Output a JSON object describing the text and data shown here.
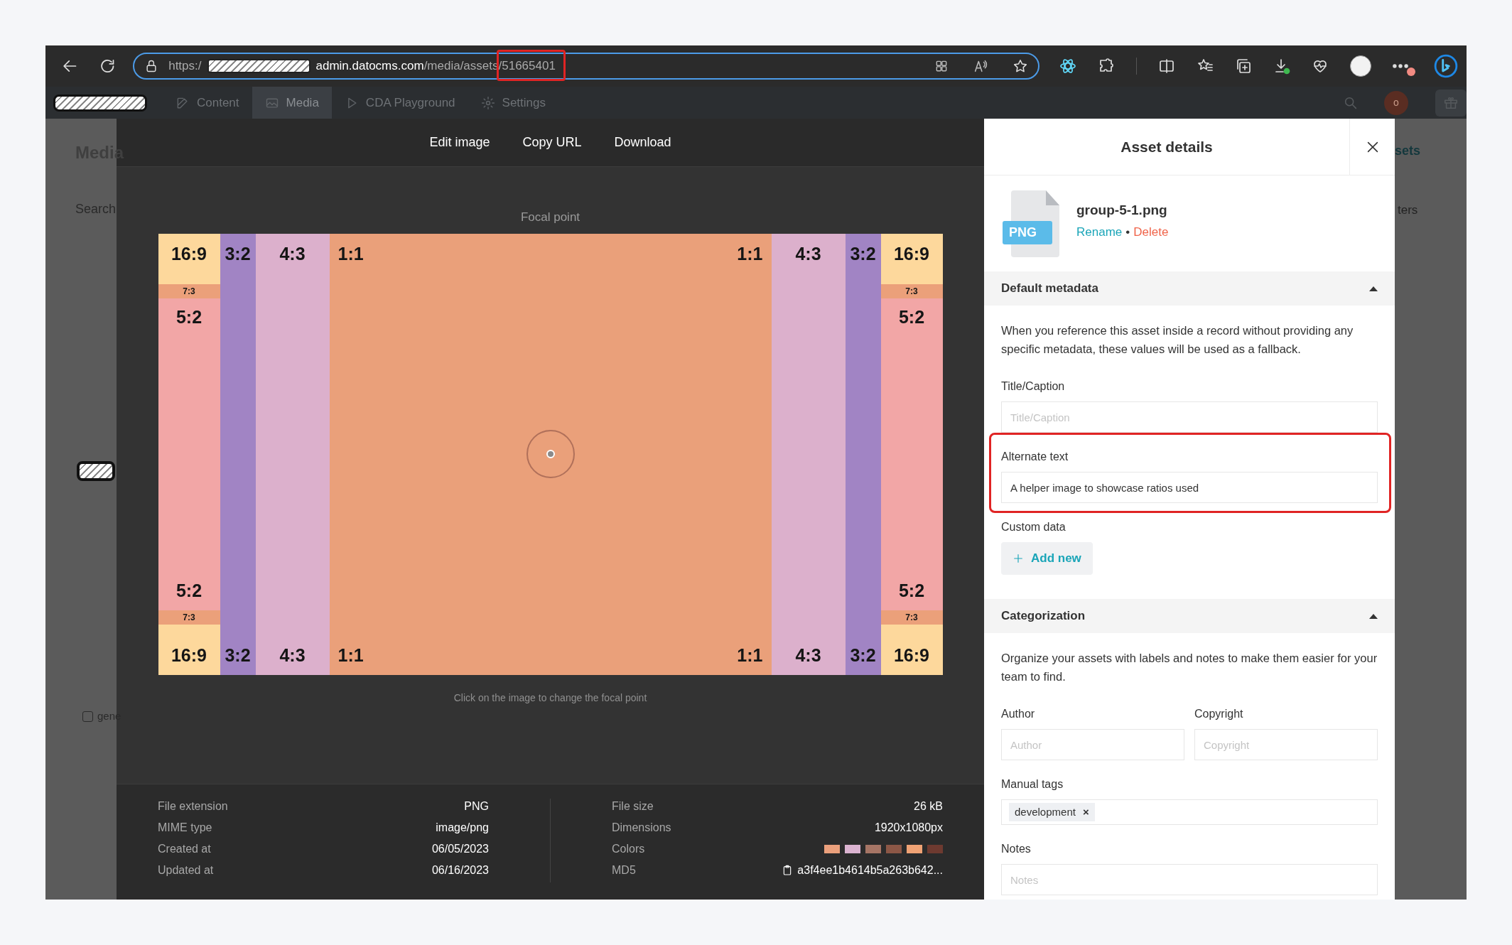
{
  "browser": {
    "url": {
      "scheme": "https:/",
      "host": "admin.datocms.com",
      "path": "/media/assets/",
      "asset_id": "51665401"
    }
  },
  "nav": {
    "items": [
      {
        "label": "Content",
        "selected": false
      },
      {
        "label": "Media",
        "selected": true
      },
      {
        "label": "CDA Playground",
        "selected": false
      },
      {
        "label": "Settings",
        "selected": false
      }
    ],
    "avatar": "o"
  },
  "background": {
    "heading": "Media",
    "search": "Search",
    "checkbox_label": "gene",
    "checkbox_checked": false,
    "right_link": "sets",
    "right_filter": "ters"
  },
  "toolbar": [
    "Edit image",
    "Copy URL",
    "Download"
  ],
  "preview": {
    "label": "Focal point",
    "hint": "Click on the image to change the focal point",
    "columns": [
      {
        "kind": "edge",
        "top": "16:9",
        "strip_top": "7:3",
        "band_top": "5:2",
        "band_bottom": "5:2",
        "strip_bottom": "7:3",
        "bottom": "16:9"
      },
      {
        "kind": "band",
        "color": "#a184c4",
        "top": "3:2",
        "bottom": "3:2"
      },
      {
        "kind": "band",
        "color": "#dcb0cc",
        "top": "4:3",
        "bottom": "4:3"
      },
      {
        "kind": "center",
        "top_left": "1:1",
        "top_right": "1:1",
        "bottom_left": "1:1",
        "bottom_right": "1:1"
      },
      {
        "kind": "band",
        "color": "#dcb0cc",
        "top": "4:3",
        "bottom": "4:3"
      },
      {
        "kind": "band",
        "color": "#a184c4",
        "top": "3:2",
        "bottom": "3:2"
      },
      {
        "kind": "edge",
        "top": "16:9",
        "strip_top": "7:3",
        "band_top": "5:2",
        "band_bottom": "5:2",
        "strip_bottom": "7:3",
        "bottom": "16:9"
      }
    ]
  },
  "info": {
    "left": [
      {
        "label": "File extension",
        "value": "PNG"
      },
      {
        "label": "MIME type",
        "value": "image/png"
      },
      {
        "label": "Created at",
        "value": "06/05/2023"
      },
      {
        "label": "Updated at",
        "value": "06/16/2023"
      }
    ],
    "right": [
      {
        "kind": "text",
        "label": "File size",
        "value": "26 kB"
      },
      {
        "kind": "text",
        "label": "Dimensions",
        "value": "1920x1080px"
      },
      {
        "kind": "colors",
        "label": "Colors",
        "colors": [
          {
            "color": "#eba07c"
          },
          {
            "color": "#dbb3d0"
          },
          {
            "color": "#a67565"
          },
          {
            "color": "#8c5746"
          },
          {
            "color": "#f0a274"
          },
          {
            "color": "#6e3a30"
          }
        ]
      },
      {
        "kind": "hash",
        "label": "MD5",
        "value": "a3f4ee1b4614b5a263b642..."
      }
    ]
  },
  "panel": {
    "title": "Asset details",
    "file": {
      "badge": "PNG",
      "name": "group-5-1.png",
      "rename": "Rename",
      "separator": "•",
      "delete": "Delete"
    },
    "sections": [
      {
        "title": "Default metadata",
        "expanded": true,
        "description": "When you reference this asset inside a record without providing any specific metadata, these values will be used as a fallback.",
        "fields": [
          {
            "kind": "text",
            "label": "Title/Caption",
            "placeholder": "Title/Caption",
            "highlighted": false
          },
          {
            "kind": "text",
            "label": "Alternate text",
            "value": "A helper image to showcase ratios used",
            "highlighted": true
          },
          {
            "kind": "custom",
            "label": "Custom data",
            "button": "Add new"
          }
        ]
      },
      {
        "title": "Categorization",
        "expanded": true,
        "description": "Organize your assets with labels and notes to make them easier for your team to find.",
        "fields": [
          {
            "kind": "pair",
            "items": [
              {
                "label": "Author",
                "placeholder": "Author"
              },
              {
                "label": "Copyright",
                "placeholder": "Copyright"
              }
            ]
          },
          {
            "kind": "tags",
            "label": "Manual tags",
            "tags": [
              {
                "label": "development",
                "remove": "×"
              }
            ]
          },
          {
            "kind": "text",
            "label": "Notes",
            "placeholder": "Notes",
            "highlighted": false
          }
        ]
      }
    ]
  }
}
